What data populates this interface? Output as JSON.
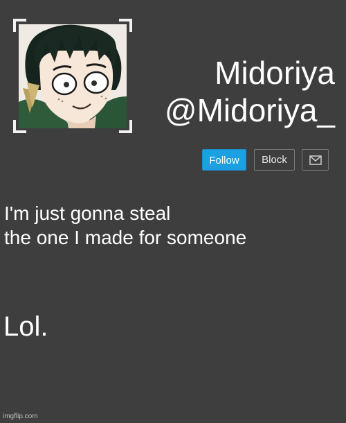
{
  "profile": {
    "display_name": "Midoriya",
    "handle": "@Midoriya_"
  },
  "actions": {
    "follow_label": "Follow",
    "block_label": "Block",
    "message_icon": "envelope-icon"
  },
  "post": {
    "line1": "I'm just gonna steal",
    "line2": "the one I made for someone",
    "line3": "Lol."
  },
  "watermark": "imgflip.com",
  "colors": {
    "background": "#3e3e3e",
    "follow_button": "#1ca0e2",
    "text": "#ffffff"
  }
}
